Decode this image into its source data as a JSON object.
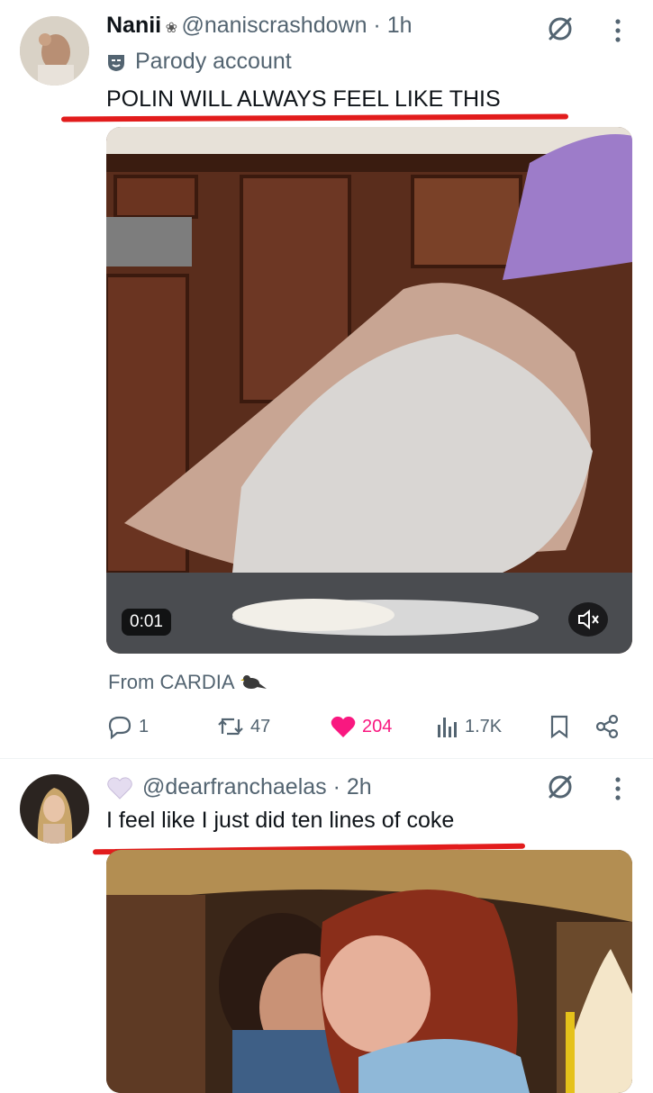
{
  "tweet1": {
    "display_name": "Nanii",
    "handle_time": "@naniscrashdown · 1h",
    "parody_label": "Parody account",
    "text": "POLIN WILL ALWAYS FEEL LIKE THIS",
    "video_time": "0:01",
    "from_label": "From CARDIA",
    "replies": "1",
    "reposts": "47",
    "likes": "204",
    "views": "1.7K"
  },
  "tweet2": {
    "handle_time": "@dearfranchaelas · 2h",
    "text": "I feel like I just did ten lines of coke"
  },
  "colors": {
    "like": "#f91880",
    "annotation_line": "#e21c1c",
    "secondary_text": "#536471"
  },
  "icons": [
    "grok-icon",
    "more-icon",
    "parody-mask-icon",
    "reply-icon",
    "repost-icon",
    "heart-icon",
    "views-icon",
    "bookmark-icon",
    "share-icon",
    "mute-icon",
    "heart-emoji-icon",
    "bird-icon"
  ]
}
